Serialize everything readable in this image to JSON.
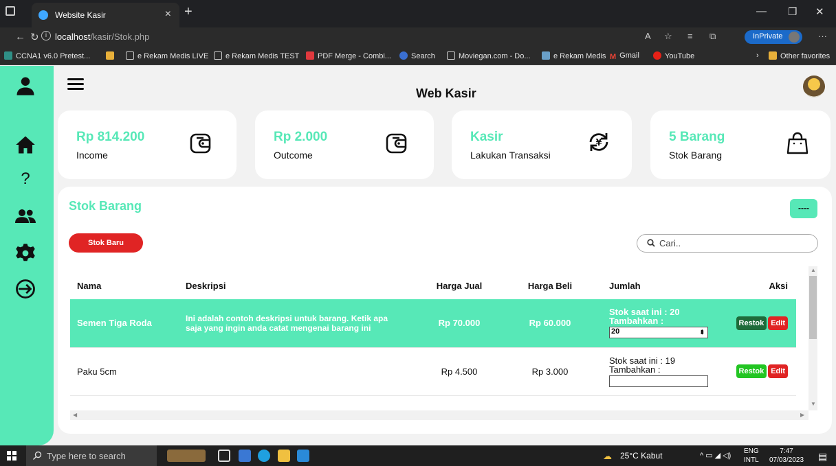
{
  "browser": {
    "tab_title": "Website Kasir",
    "tab_close": "×",
    "new_tab": "+",
    "url_host": "localhost",
    "url_path": "/kasir/Stok.php",
    "inprivate": "InPrivate",
    "favorites": [
      "CCNA1 v6.0 Pretest...",
      "e Rekam Medis LIVE",
      "e Rekam Medis TEST",
      "PDF Merge - Combi...",
      "Search",
      "Moviegan.com - Do...",
      "e Rekam Medis",
      "Gmail",
      "YouTube"
    ],
    "other_favorites": "Other favorites"
  },
  "app": {
    "title": "Web Kasir",
    "cards": [
      {
        "value": "Rp 814.200",
        "label": "Income",
        "icon": "wallet-icon"
      },
      {
        "value": "Rp 2.000",
        "label": "Outcome",
        "icon": "wallet-icon"
      },
      {
        "value": "Kasir",
        "label": "Lakukan Transaksi",
        "icon": "currency-exchange-icon"
      },
      {
        "value": "5 Barang",
        "label": "Stok Barang",
        "icon": "shopping-bag-icon"
      }
    ],
    "panel_title": "Stok Barang",
    "dash_button": "----",
    "new_stock_button": "Stok Baru",
    "search_placeholder": "Cari..",
    "table": {
      "headers": [
        "Nama",
        "Deskripsi",
        "Harga Jual",
        "Harga Beli",
        "Jumlah",
        "Aksi"
      ],
      "rows": [
        {
          "nama": "Semen Tiga Roda",
          "deskripsi": "Ini adalah contoh deskripsi untuk barang. Ketik apa saja yang ingin anda catat mengenai barang ini",
          "harga_jual": "Rp 70.000",
          "harga_beli": "Rp 60.000",
          "stok": "Stok saat ini : 20",
          "tambahkan": "Tambahkan :",
          "input_value": "20",
          "restok": "Restok",
          "edit": "Edit"
        },
        {
          "nama": "Paku 5cm",
          "deskripsi": "",
          "harga_jual": "Rp 4.500",
          "harga_beli": "Rp 3.000",
          "stok": "Stok saat ini : 19",
          "tambahkan": "Tambahkan :",
          "input_value": "",
          "restok": "Restok",
          "edit": "Edit"
        }
      ]
    }
  },
  "taskbar": {
    "search_placeholder": "Type here to search",
    "weather": "25°C Kabut",
    "lang": "ENG",
    "lang2": "INTL",
    "time": "7:47",
    "date": "07/03/2023"
  },
  "colors": {
    "accent": "#57e8b7",
    "danger": "#e02424",
    "restok_dark": "#1e6b3a",
    "restok_bright": "#22c522"
  }
}
